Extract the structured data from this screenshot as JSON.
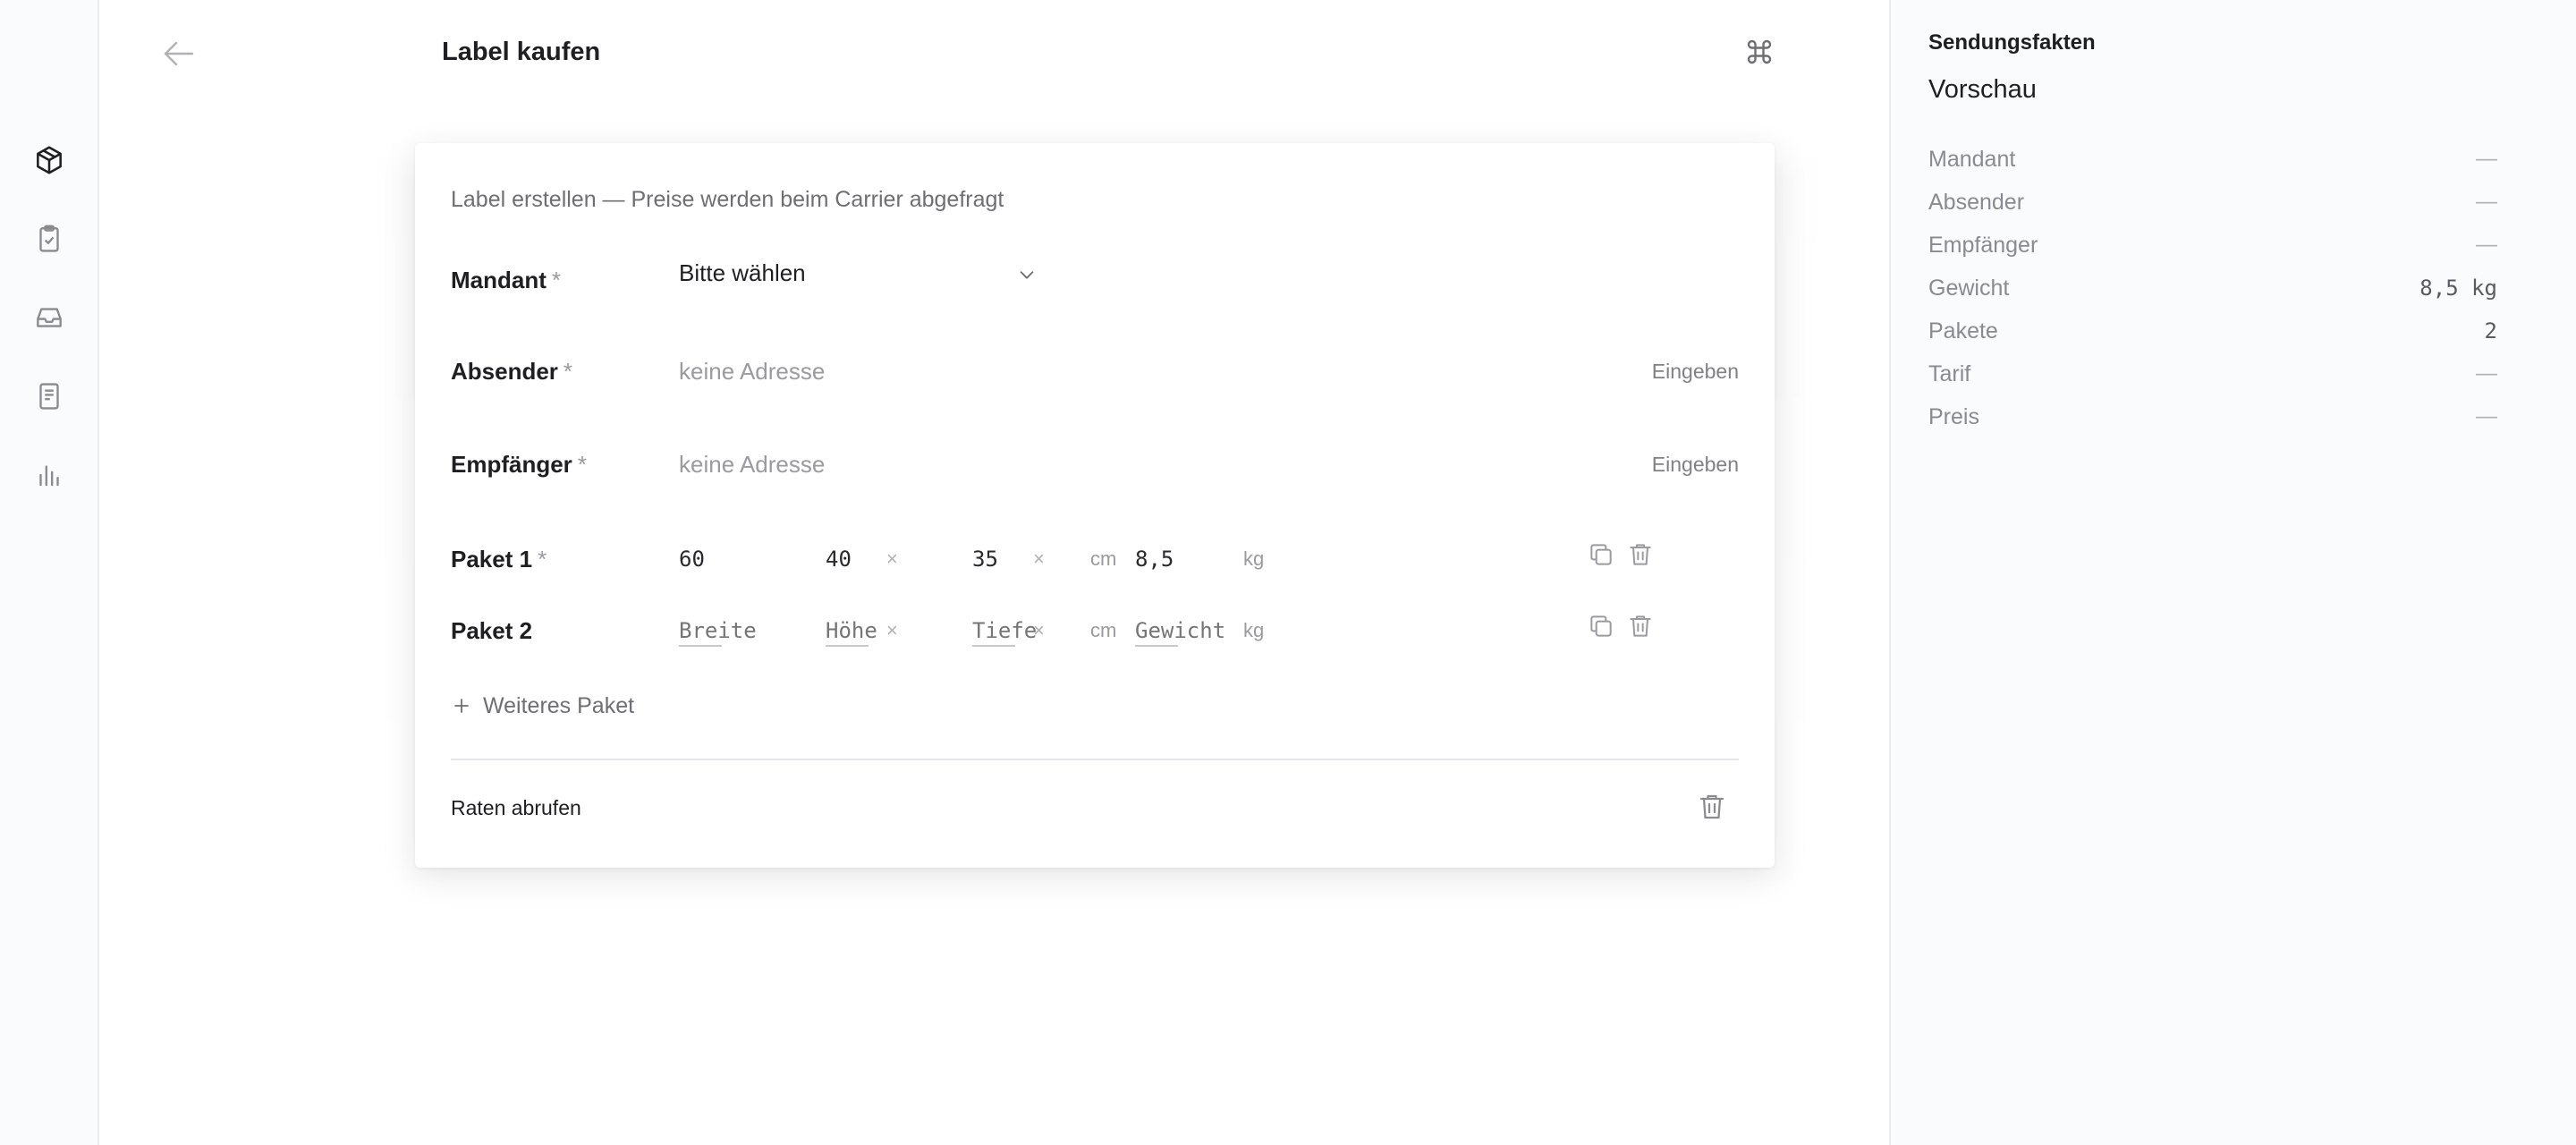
{
  "page": {
    "title": "Label kaufen"
  },
  "rail": {
    "icons": [
      "package-icon",
      "clipboard-check-icon",
      "inbox-icon",
      "document-icon",
      "bar-chart-icon"
    ]
  },
  "card": {
    "subtitle": "Label erstellen — Preise werden beim Carrier abgefragt",
    "required_mark": "*",
    "mandant": {
      "label": "Mandant",
      "value": "Bitte wählen"
    },
    "absender": {
      "label": "Absender",
      "value": "keine Adresse",
      "action": "Eingeben"
    },
    "empfaenger": {
      "label": "Empfänger",
      "value": "keine Adresse",
      "action": "Eingeben"
    },
    "packages": [
      {
        "label": "Paket 1",
        "required": true,
        "breite": "60",
        "hoehe": "40",
        "tiefe": "35",
        "gewicht": "8,5"
      },
      {
        "label": "Paket 2",
        "required": false,
        "breite": "",
        "hoehe": "",
        "tiefe": "",
        "gewicht": ""
      }
    ],
    "placeholders": {
      "breite": "Breite",
      "hoehe": "Höhe",
      "tiefe": "Tiefe",
      "gewicht": "Gewicht"
    },
    "times_sign": "×",
    "unit_cm": "cm",
    "unit_kg": "kg",
    "add_package": "Weiteres Paket",
    "fetch_rates": "Raten abrufen"
  },
  "side": {
    "kicker": "Sendungsfakten",
    "title": "Vorschau",
    "facts": [
      {
        "key": "Mandant",
        "value": "—"
      },
      {
        "key": "Absender",
        "value": "—"
      },
      {
        "key": "Empfänger",
        "value": "—"
      },
      {
        "key": "Gewicht",
        "value": "8,5 kg"
      },
      {
        "key": "Pakete",
        "value": "2"
      },
      {
        "key": "Tarif",
        "value": "—"
      },
      {
        "key": "Preis",
        "value": "—"
      }
    ]
  }
}
